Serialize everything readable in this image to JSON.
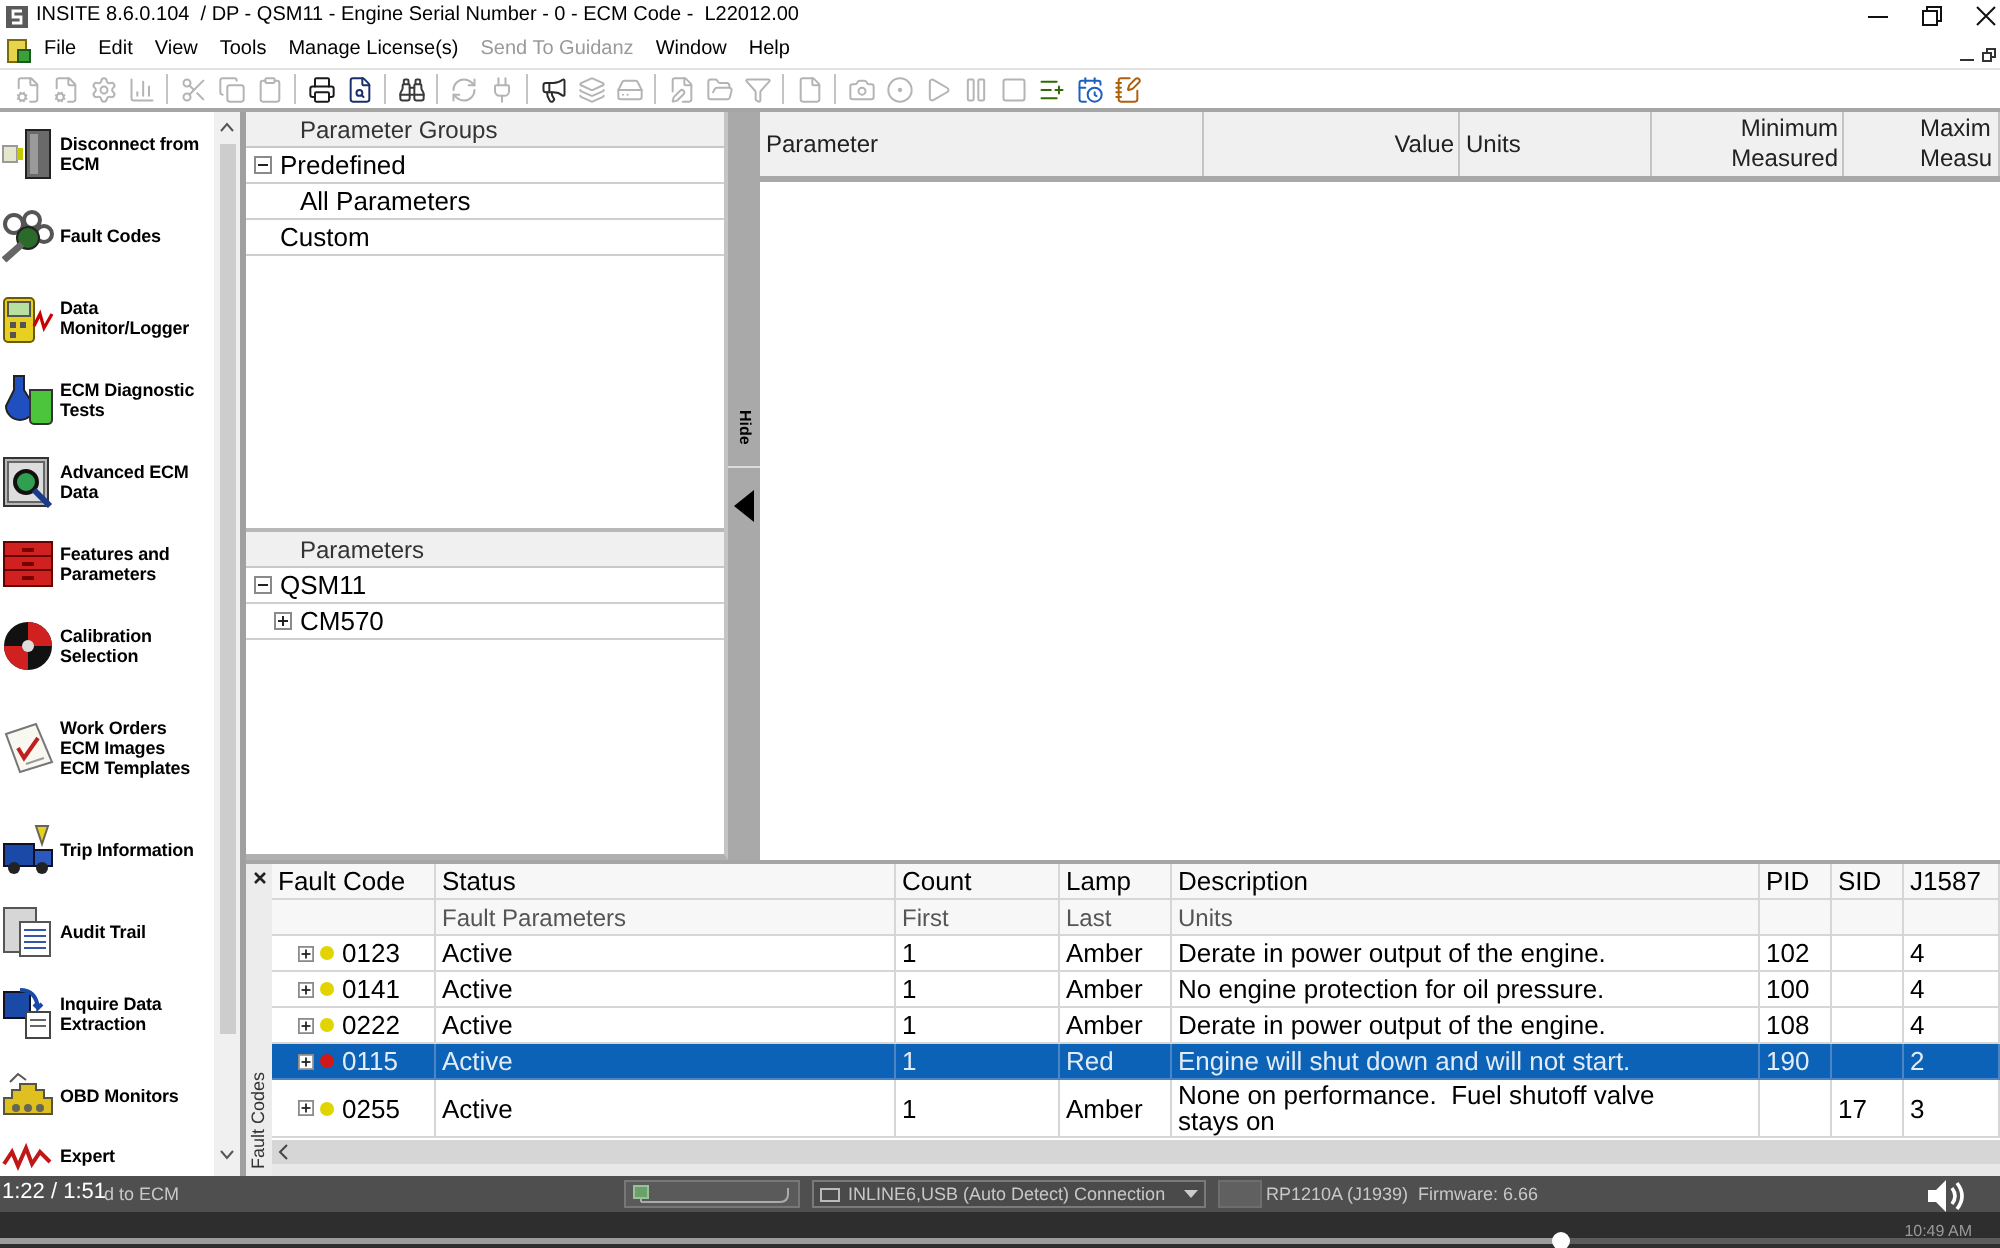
{
  "title_bar": {
    "title": "INSITE 8.6.0.104  / DP - QSM11 - Engine Serial Number - 0 - ECM Code -  L22012.00"
  },
  "menu": [
    {
      "label": "File",
      "disabled": false
    },
    {
      "label": "Edit",
      "disabled": false
    },
    {
      "label": "View",
      "disabled": false
    },
    {
      "label": "Tools",
      "disabled": false
    },
    {
      "label": "Manage License(s)",
      "disabled": false
    },
    {
      "label": "Send To Guidanz",
      "disabled": true
    },
    {
      "label": "Window",
      "disabled": false
    },
    {
      "label": "Help",
      "disabled": false
    }
  ],
  "toolbar_groups": [
    [
      {
        "disabled": true
      },
      {
        "disabled": true
      },
      {
        "disabled": true
      },
      {
        "disabled": true
      }
    ],
    [
      {
        "disabled": true
      },
      {
        "disabled": true
      },
      {
        "disabled": true
      }
    ],
    [
      {
        "disabled": false
      },
      {
        "disabled": false
      }
    ],
    [
      {
        "disabled": false
      }
    ],
    [
      {
        "disabled": true
      },
      {
        "disabled": true
      }
    ],
    [
      {
        "disabled": false
      },
      {
        "disabled": true
      },
      {
        "disabled": true
      }
    ],
    [
      {
        "disabled": true
      },
      {
        "disabled": true
      },
      {
        "disabled": true
      }
    ],
    [
      {
        "disabled": true
      }
    ],
    [
      {
        "disabled": true
      },
      {
        "disabled": true
      },
      {
        "disabled": true
      },
      {
        "disabled": true
      },
      {
        "disabled": true
      },
      {
        "disabled": false
      },
      {
        "disabled": false
      },
      {
        "disabled": false
      }
    ]
  ],
  "sidebar": {
    "items": [
      {
        "lines": [
          "Disconnect from",
          "ECM"
        ]
      },
      {
        "lines": [
          "Fault Codes"
        ]
      },
      {
        "lines": [
          "Data",
          "Monitor/Logger"
        ]
      },
      {
        "lines": [
          "ECM Diagnostic",
          "Tests"
        ]
      },
      {
        "lines": [
          "Advanced ECM",
          "Data"
        ]
      },
      {
        "lines": [
          "Features and",
          "Parameters"
        ]
      },
      {
        "lines": [
          "Calibration",
          "Selection"
        ]
      },
      {
        "lines": [
          "Work Orders",
          "ECM Images",
          "ECM Templates"
        ]
      },
      {
        "lines": [
          "Trip Information"
        ]
      },
      {
        "lines": [
          "Audit Trail"
        ]
      },
      {
        "lines": [
          "Inquire Data",
          "Extraction"
        ]
      },
      {
        "lines": [
          "OBD Monitors"
        ]
      },
      {
        "lines": [
          "Expert"
        ]
      }
    ]
  },
  "parameter_groups": {
    "header": "Parameter Groups",
    "items": [
      {
        "label": "Predefined",
        "expanded": true,
        "children": [
          {
            "label": "All Parameters"
          }
        ]
      },
      {
        "label": "Custom"
      }
    ]
  },
  "parameters": {
    "header": "Parameters",
    "items": [
      {
        "label": "QSM11",
        "expanded": true,
        "children": [
          {
            "label": "CM570",
            "expanded": false
          }
        ]
      }
    ]
  },
  "splitter": {
    "label": "Hide"
  },
  "parameter_table": {
    "columns": [
      {
        "lines": [
          "Parameter"
        ]
      },
      {
        "lines": [
          "Value"
        ]
      },
      {
        "lines": [
          "Units"
        ]
      },
      {
        "lines": [
          "Minimum",
          "Measured"
        ]
      },
      {
        "lines": [
          "Maxim",
          "Measu"
        ]
      }
    ]
  },
  "fault_codes": {
    "tab_label": "Fault Codes",
    "columns": [
      {
        "label": "Fault Code"
      },
      {
        "label": "Status",
        "sub": "Fault Parameters"
      },
      {
        "label": "Count",
        "sub": "First"
      },
      {
        "label": "Lamp",
        "sub": "Last"
      },
      {
        "label": "Description",
        "sub": "Units"
      },
      {
        "label": "PID"
      },
      {
        "label": "SID"
      },
      {
        "label": "J1587"
      }
    ],
    "rows": [
      {
        "code": "0123",
        "status": "Active",
        "count": "1",
        "lamp": "Amber",
        "description": "Derate in power output of the engine.",
        "pid": "102",
        "j1587": "4",
        "color": "#e2d400",
        "selected": false,
        "expanded": false
      },
      {
        "code": "0141",
        "status": "Active",
        "count": "1",
        "lamp": "Amber",
        "description": "No engine protection for oil pressure.",
        "pid": "100",
        "j1587": "4",
        "color": "#e2d400",
        "selected": false,
        "expanded": false
      },
      {
        "code": "0222",
        "status": "Active",
        "count": "1",
        "lamp": "Amber",
        "description": "Derate in power output of the engine.",
        "pid": "108",
        "j1587": "4",
        "color": "#e2d400",
        "selected": false,
        "expanded": false
      },
      {
        "code": "0115",
        "status": "Active",
        "count": "1",
        "lamp": "Red",
        "description": "Engine will shut down and will not start.",
        "pid": "190",
        "j1587": "2",
        "color": "#d01818",
        "selected": true,
        "expanded": false
      },
      {
        "code": "0255",
        "status": "Active",
        "count": "1",
        "lamp": "Amber",
        "description": "None on performance.  Fuel shutoff valve\nstays on",
        "sid": "17",
        "j1587": "3",
        "color": "#e2d400",
        "selected": false,
        "expanded": false
      }
    ]
  },
  "status_bar": {
    "text": "d to ECM",
    "connection": "INLINE6,USB (Auto Detect) Connection",
    "adapter": "RP1210A (J1939)  Firmware: 6.66"
  },
  "video_player": {
    "time": "1:22 / 1:51",
    "level": 0.78
  },
  "taskbar": {
    "clock": "10:49 AM"
  }
}
